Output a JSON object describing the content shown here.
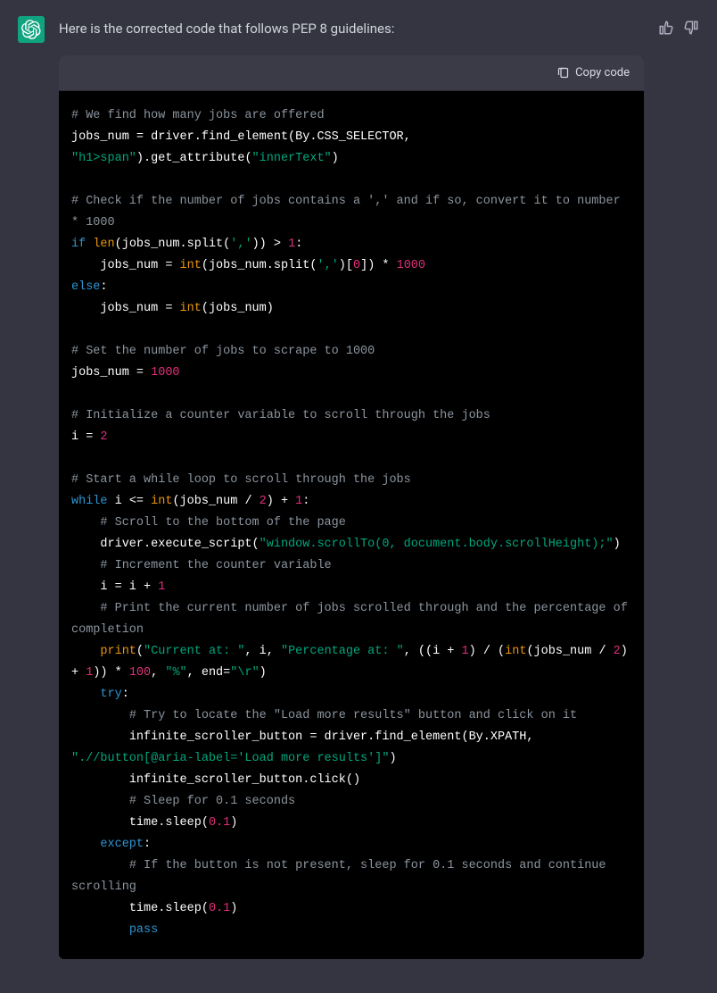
{
  "intro": "Here is the corrected code that follows PEP 8 guidelines:",
  "copy_label": "Copy code",
  "code": {
    "c1": "# We find how many jobs are offered",
    "l2a": "jobs_num = driver.find_element(By.CSS_SELECTOR,",
    "l3a": "\"h1>span\"",
    "l3b": ").get_attribute(",
    "l3c": "\"innerText\"",
    "l3d": ")",
    "c4": "# Check if the number of jobs contains a ',' and if so, convert it to number * 1000",
    "kw_if": "if",
    "len": "len",
    "l5a": "(jobs_num.split(",
    "l5b": "','",
    "l5c": ")) > ",
    "n1": "1",
    "l5d": ":",
    "l6a": "    jobs_num = ",
    "int": "int",
    "l6b": "(jobs_num.split(",
    "l6c": "','",
    "l6d": ")[",
    "n0": "0",
    "l6e": "]) * ",
    "n1000": "1000",
    "kw_else": "else",
    "l8a": "    jobs_num = ",
    "l8b": "(jobs_num)",
    "c9": "# Set the number of jobs to scrape to 1000",
    "l10a": "jobs_num = ",
    "c11": "# Initialize a counter variable to scroll through the jobs",
    "l12a": "i = ",
    "n2": "2",
    "c13": "# Start a while loop to scroll through the jobs",
    "kw_while": "while",
    "l14a": " i <= ",
    "l14b": "(jobs_num / ",
    "l14c": ") + ",
    "c15": "    # Scroll to the bottom of the page",
    "l16a": "    driver.execute_script(",
    "l16b": "\"window.scrollTo(0, document.body.scrollHeight);\"",
    "l16c": ")",
    "c17": "    # Increment the counter variable",
    "l18a": "    i = i + ",
    "c19": "    # Print the current number of jobs scrolled through and the percentage of completion",
    "print": "print",
    "l20a": "(",
    "s20a": "\"Current at: \"",
    "l20b": ", i, ",
    "s20b": "\"Percentage at: \"",
    "l20c": ", ((i + ",
    "l20d": ") / (",
    "l20e": "(jobs_num / ",
    "l20f": ") + ",
    "l20g": ")) * ",
    "n100": "100",
    "l20h": ", ",
    "s20c": "\"%\"",
    "l20i": ", end=",
    "s20d": "\"\\r\"",
    "l20j": ")",
    "kw_try": "try",
    "c21": "        # Try to locate the \"Load more results\" button and click on it",
    "l22a": "        infinite_scroller_button = driver.find_element(By.XPATH, ",
    "s22a": "\".//button[@aria-label='Load more results']\"",
    "l22b": ")",
    "l23a": "        infinite_scroller_button.click()",
    "c24": "        # Sleep for 0.1 seconds",
    "l25a": "        time.sleep(",
    "n01": "0.1",
    "l25b": ")",
    "kw_except": "except",
    "c26": "        # If the button is not present, sleep for 0.1 seconds and continue scrolling",
    "l27a": "        time.sleep(",
    "l27b": ")",
    "kw_pass": "pass",
    "indent4": "    ",
    "indent8": "        "
  }
}
